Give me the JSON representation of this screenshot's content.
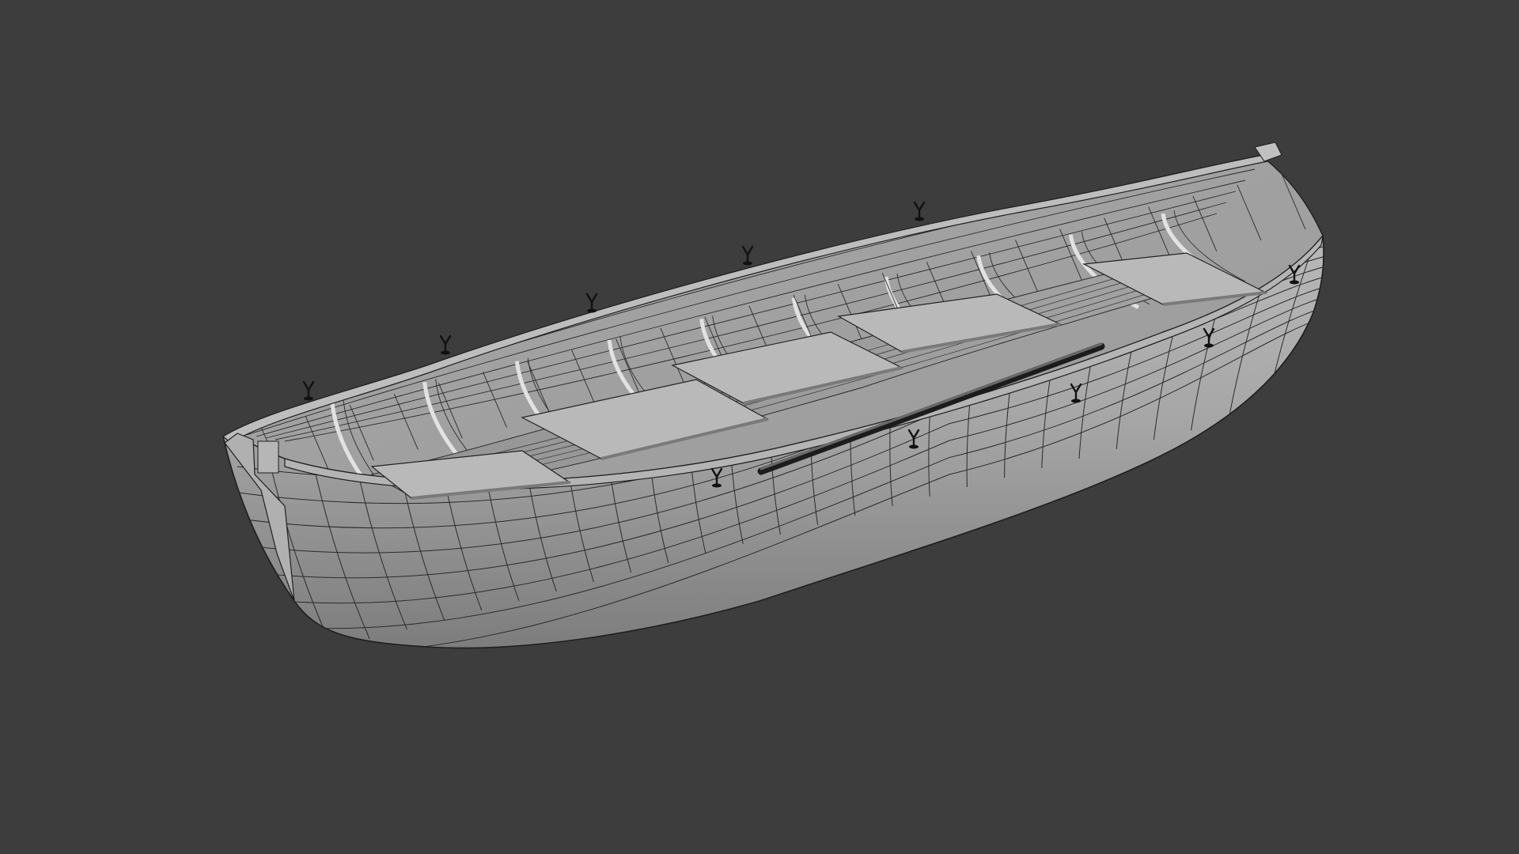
{
  "viewport": {
    "background_color": "#3d3d3d",
    "object": "rowboat-wireframe-model",
    "shading": "solid-with-wireframe",
    "mesh_color": "#a9a9a9",
    "edge_color": "#222222"
  },
  "oarlocks": {
    "count": 10,
    "icon": "oarlock-icon"
  },
  "thwarts": {
    "count": 5
  },
  "ribs": {
    "count": 10
  }
}
